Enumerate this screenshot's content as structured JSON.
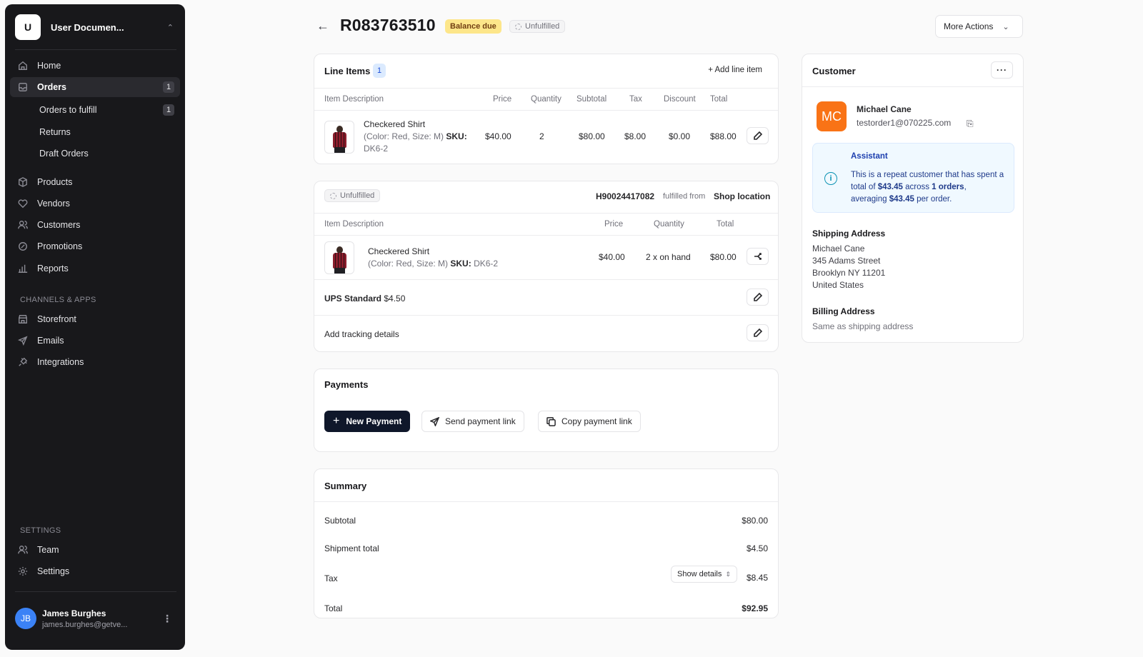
{
  "workspace": {
    "initial": "U",
    "name": "User Documen..."
  },
  "sidebar": {
    "items": [
      {
        "label": "Home"
      },
      {
        "label": "Orders",
        "count": "1"
      },
      {
        "label": "Orders to fulfill",
        "count": "1"
      },
      {
        "label": "Returns"
      },
      {
        "label": "Draft Orders"
      },
      {
        "label": "Products"
      },
      {
        "label": "Vendors"
      },
      {
        "label": "Customers"
      },
      {
        "label": "Promotions"
      },
      {
        "label": "Reports"
      }
    ],
    "channels_title": "CHANNELS & APPS",
    "channels": [
      {
        "label": "Storefront"
      },
      {
        "label": "Emails"
      },
      {
        "label": "Integrations"
      }
    ],
    "settings_title": "SETTINGS",
    "settings": [
      {
        "label": "Team"
      },
      {
        "label": "Settings"
      }
    ]
  },
  "user": {
    "initials": "JB",
    "name": "James Burghes",
    "email": "james.burghes@getve..."
  },
  "header": {
    "order_id": "R083763510",
    "balance_badge": "Balance due",
    "status_badge": "Unfulfilled",
    "more_actions": "More Actions"
  },
  "line_items": {
    "title": "Line Items",
    "count": "1",
    "add_label": "+ Add line item",
    "columns": [
      "Item Description",
      "Price",
      "Quantity",
      "Subtotal",
      "Tax",
      "Discount",
      "Total"
    ],
    "row": {
      "name": "Checkered Shirt",
      "variant": "(Color: Red, Size: M)",
      "sku_label": "SKU:",
      "sku": "DK6-2",
      "price": "$40.00",
      "quantity": "2",
      "subtotal": "$80.00",
      "tax": "$8.00",
      "discount": "$0.00",
      "total": "$88.00"
    }
  },
  "fulfillment": {
    "status": "Unfulfilled",
    "code": "H90024417082",
    "from_label": "fulfilled from",
    "location": "Shop location",
    "columns": [
      "Item Description",
      "Price",
      "Quantity",
      "Total"
    ],
    "row": {
      "name": "Checkered Shirt",
      "variant": "(Color: Red, Size: M)",
      "sku_label": "SKU:",
      "sku": "DK6-2",
      "price": "$40.00",
      "quantity": "2 x on hand",
      "total": "$80.00"
    },
    "shipping_method": "UPS Standard",
    "shipping_price": "$4.50",
    "tracking": "Add tracking details"
  },
  "payments": {
    "title": "Payments",
    "new_payment": "New Payment",
    "send_link": "Send payment link",
    "copy_link": "Copy payment link"
  },
  "summary": {
    "title": "Summary",
    "subtotal_label": "Subtotal",
    "subtotal": "$80.00",
    "shipment_label": "Shipment total",
    "shipment": "$4.50",
    "tax_label": "Tax",
    "tax_details": "Show details",
    "tax": "$8.45",
    "total_label": "Total",
    "total": "$92.95"
  },
  "customer": {
    "title": "Customer",
    "initials": "MC",
    "name": "Michael Cane",
    "email": "testorder1@070225.com",
    "assistant_title": "Assistant",
    "assistant_pre": "This is a repeat customer that has spent a total of ",
    "assistant_amount": "$43.45",
    "assistant_mid": " across ",
    "assistant_orders": "1 orders",
    "assistant_mid2": ", averaging ",
    "assistant_avg": "$43.45",
    "assistant_post": " per order.",
    "shipping_title": "Shipping Address",
    "shipping_lines": [
      "Michael Cane",
      "345 Adams Street",
      "Brooklyn NY 11201",
      "United States"
    ],
    "billing_title": "Billing Address",
    "billing_text": "Same as shipping address"
  }
}
